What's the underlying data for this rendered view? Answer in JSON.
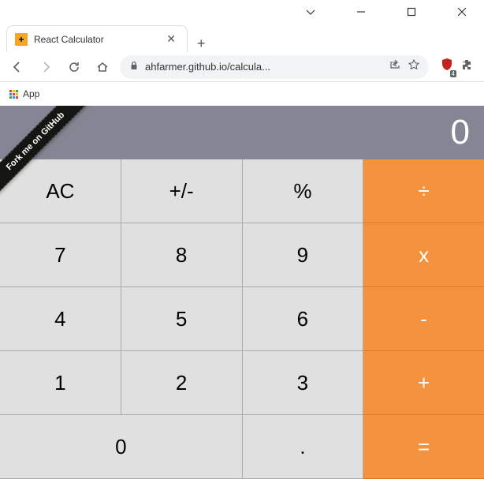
{
  "browser": {
    "tab_title": "React Calculator",
    "favicon_glyph": "+",
    "url_display": "ahfarmer.github.io/calcula...",
    "bookmarks_app_label": "App",
    "shield_badge": "4"
  },
  "calculator": {
    "display_value": "0",
    "github_ribbon": "Fork me on GitHub",
    "buttons": {
      "ac": "AC",
      "sign": "+/-",
      "percent": "%",
      "divide": "÷",
      "seven": "7",
      "eight": "8",
      "nine": "9",
      "multiply": "x",
      "four": "4",
      "five": "5",
      "six": "6",
      "subtract": "-",
      "one": "1",
      "two": "2",
      "three": "3",
      "add": "+",
      "zero": "0",
      "decimal": ".",
      "equals": "="
    }
  }
}
